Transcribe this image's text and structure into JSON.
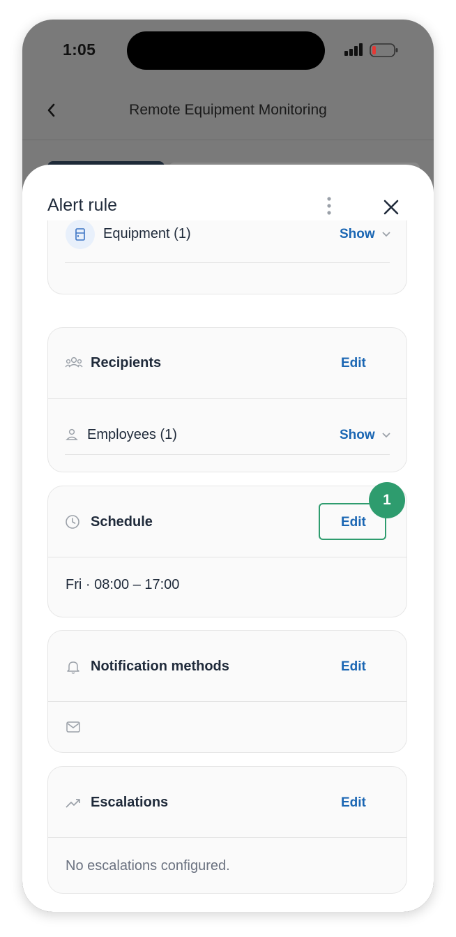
{
  "status_bar": {
    "time": "1:05"
  },
  "nav": {
    "title": "Remote Equipment Monitoring"
  },
  "sheet": {
    "title": "Alert rule",
    "equipment": {
      "label": "Equipment (1)",
      "action": "Show"
    },
    "recipients": {
      "label": "Recipients",
      "action": "Edit",
      "employees": {
        "label": "Employees (1)",
        "action": "Show"
      }
    },
    "schedule": {
      "label": "Schedule",
      "action": "Edit",
      "badge": "1",
      "value": "Fri · 08:00 – 17:00"
    },
    "notifications": {
      "label": "Notification methods",
      "action": "Edit"
    },
    "escalations": {
      "label": "Escalations",
      "action": "Edit",
      "empty": "No escalations configured."
    }
  },
  "colors": {
    "accent_blue": "#1a66b3",
    "highlight_green": "#2e9c6e",
    "battery_low": "#e53935"
  }
}
